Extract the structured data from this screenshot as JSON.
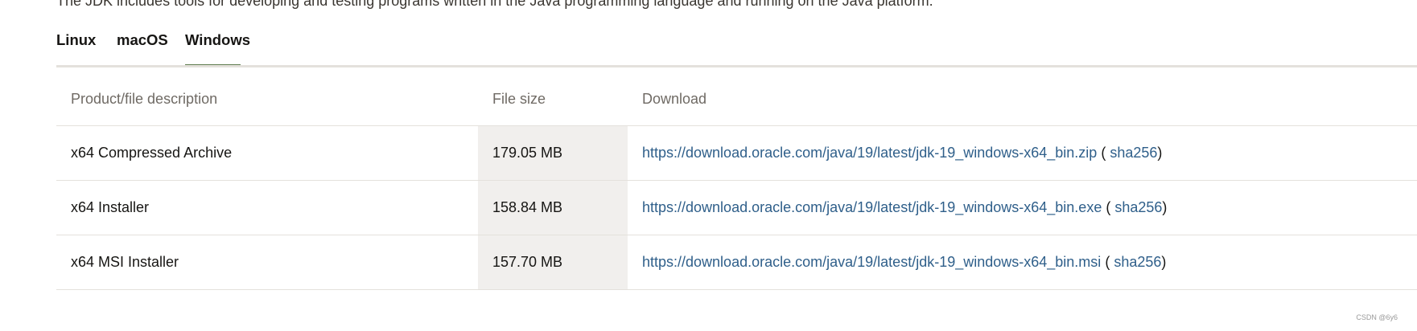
{
  "intro_text": "The JDK includes tools for developing and testing programs written in the Java programming language and running on the Java platform.",
  "tabs": [
    {
      "label": "Linux",
      "active": false
    },
    {
      "label": "macOS",
      "active": false
    },
    {
      "label": "Windows",
      "active": true
    }
  ],
  "table": {
    "headers": [
      "Product/file description",
      "File size",
      "Download"
    ],
    "rows": [
      {
        "description": "x64 Compressed Archive",
        "size": "179.05 MB",
        "url": "https://download.oracle.com/java/19/latest/jdk-19_windows-x64_bin.zip",
        "checksum": "sha256"
      },
      {
        "description": "x64 Installer",
        "size": "158.84 MB",
        "url": "https://download.oracle.com/java/19/latest/jdk-19_windows-x64_bin.exe",
        "checksum": "sha256"
      },
      {
        "description": "x64 MSI Installer",
        "size": "157.70 MB",
        "url": "https://download.oracle.com/java/19/latest/jdk-19_windows-x64_bin.msi",
        "checksum": "sha256"
      }
    ]
  },
  "watermark": "CSDN @6y6",
  "colors": {
    "active_tab_underline": "#5f7d4f",
    "link": "#2f5f8a",
    "size_cell_bg": "#f1efed"
  }
}
